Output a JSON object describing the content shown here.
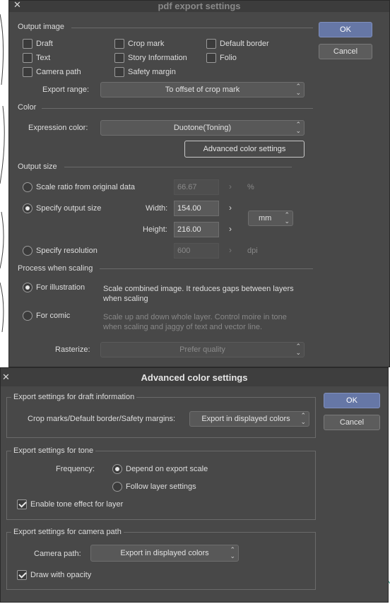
{
  "colors": {
    "accent": "#6677a6",
    "panel": "#484848",
    "titlebar": "#3c3c3c"
  },
  "pdf_dialog": {
    "title": "pdf export settings",
    "close_icon": "close-icon",
    "ok": "OK",
    "cancel": "Cancel",
    "output_image": {
      "section": "Output image",
      "draft": "Draft",
      "text": "Text",
      "camera_path": "Camera path",
      "crop_mark": "Crop mark",
      "story_information": "Story Information",
      "safety_margin": "Safety margin",
      "default_border": "Default border",
      "folio": "Folio",
      "export_range_label": "Export range:",
      "export_range_value": "To offset of crop mark"
    },
    "color": {
      "section": "Color",
      "expression_label": "Expression color:",
      "expression_value": "Duotone(Toning)",
      "advanced_button": "Advanced color settings"
    },
    "output_size": {
      "section": "Output size",
      "scale_ratio": "Scale ratio from original data",
      "scale_value": "66.67",
      "scale_unit": "%",
      "specify_output": "Specify output size",
      "width_label": "Width:",
      "width_value": "154.00",
      "height_label": "Height:",
      "height_value": "216.00",
      "unit": "mm",
      "specify_resolution": "Specify resolution",
      "resolution_value": "600",
      "resolution_unit": "dpi"
    },
    "process": {
      "section": "Process when scaling",
      "illustration": "For illustration",
      "illustration_desc": "Scale combined image. It reduces gaps between layers when scaling",
      "comic": "For comic",
      "comic_desc": "Scale up and down whole layer. Control moire in tone when scaling and jaggy of text and vector line.",
      "rasterize_label": "Rasterize:",
      "rasterize_value": "Prefer quality"
    }
  },
  "adv_dialog": {
    "title": "Advanced color settings",
    "close_icon": "close-icon",
    "ok": "OK",
    "cancel": "Cancel",
    "draft_group": {
      "legend": "Export settings for draft information",
      "label": "Crop marks/Default border/Safety margins:",
      "value": "Export in displayed colors"
    },
    "tone_group": {
      "legend": "Export settings for tone",
      "frequency_label": "Frequency:",
      "depend": "Depend on export scale",
      "follow": "Follow layer settings",
      "enable": "Enable tone effect for layer"
    },
    "camera_group": {
      "legend": "Export settings for camera path",
      "label": "Camera path:",
      "value": "Export in displayed colors",
      "opacity": "Draw with opacity"
    }
  }
}
